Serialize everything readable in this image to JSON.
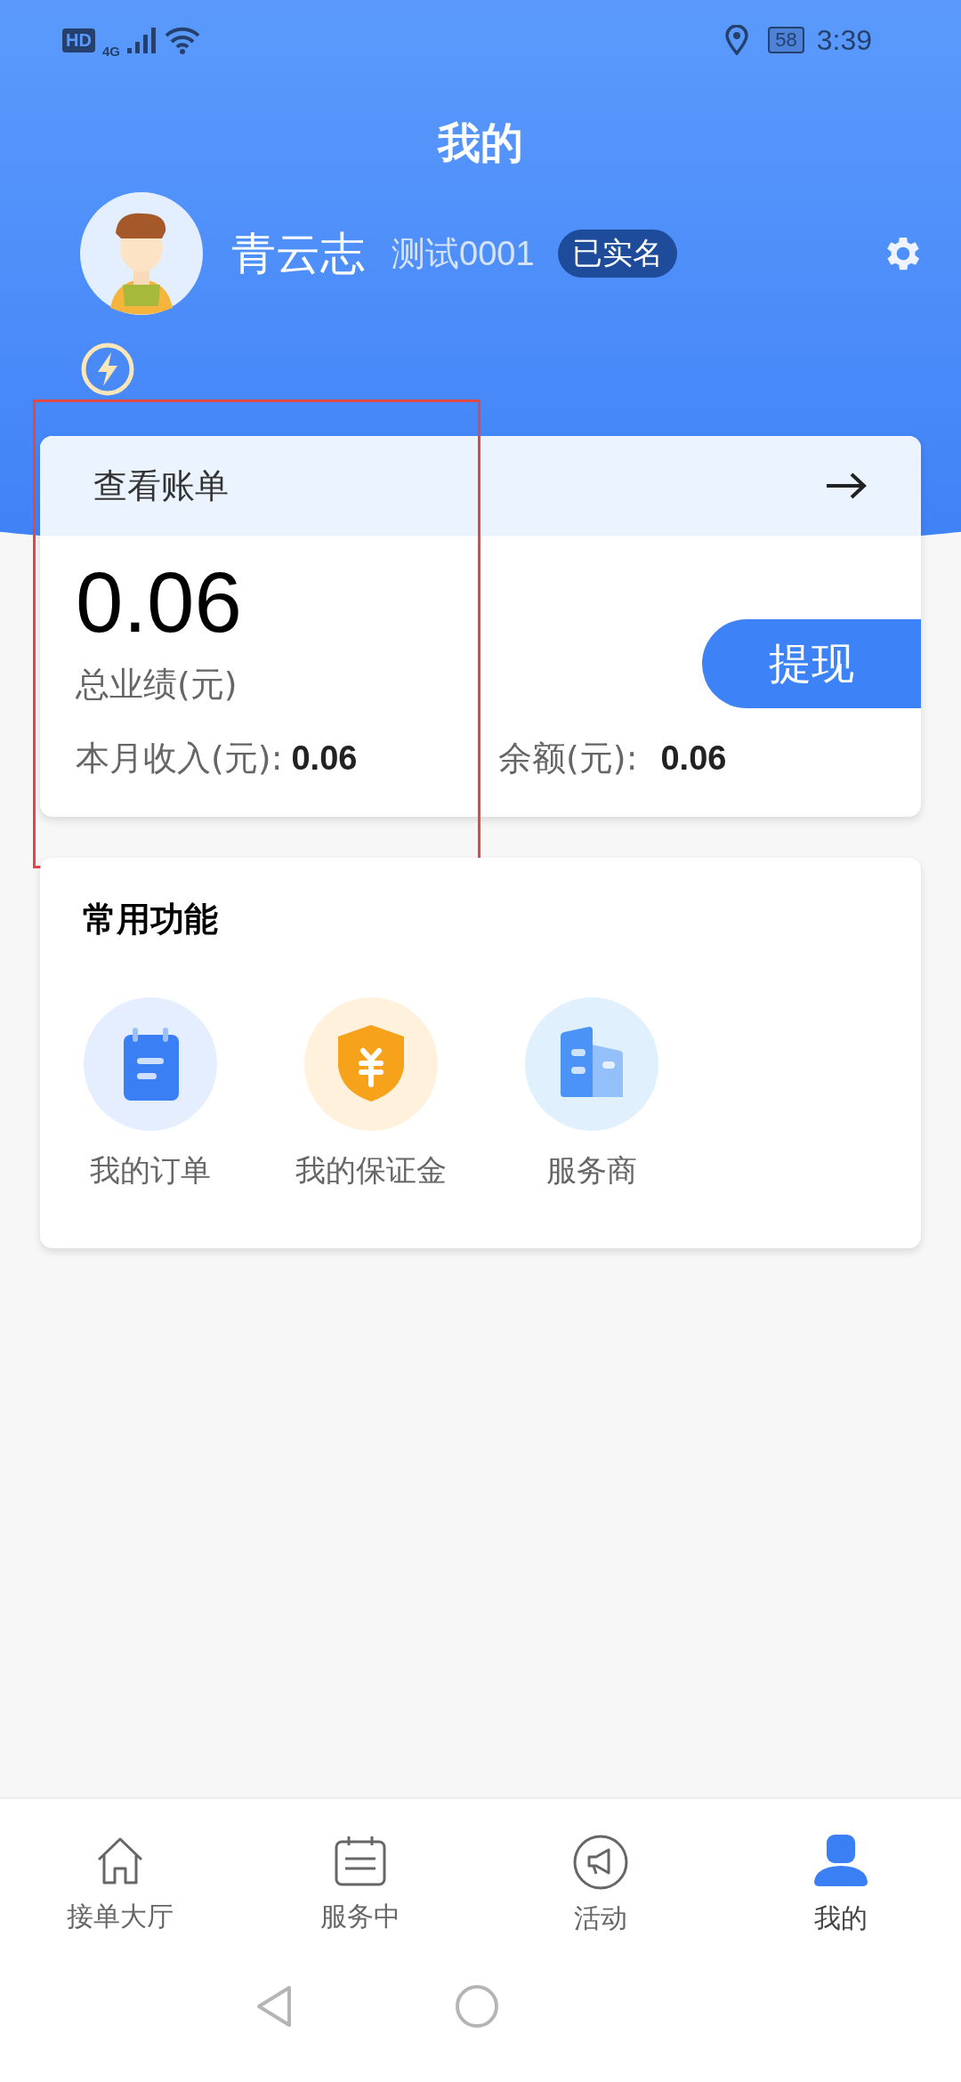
{
  "status_bar": {
    "hd": "HD",
    "network": "4G",
    "battery": "58",
    "time": "3:39"
  },
  "header": {
    "title": "我的"
  },
  "profile": {
    "name": "青云志",
    "account": "测试0001",
    "badge": "已实名"
  },
  "bill_card": {
    "link": "查看账单",
    "total": "0.06",
    "total_label": "总业绩(元)",
    "withdraw_button": "提现",
    "month_label": "本月收入(元):",
    "month_value": "0.06",
    "balance_label": "余额(元):",
    "balance_value": "0.06"
  },
  "functions": {
    "title": "常用功能",
    "items": [
      {
        "kind": "orders",
        "label": "我的订单"
      },
      {
        "kind": "deposit",
        "label": "我的保证金"
      },
      {
        "kind": "provider",
        "label": "服务商"
      }
    ]
  },
  "tabs": [
    {
      "kind": "home",
      "label": "接单大厅",
      "selected": false
    },
    {
      "kind": "calendar",
      "label": "服务中",
      "selected": false
    },
    {
      "kind": "megaphone",
      "label": "活动",
      "selected": false
    },
    {
      "kind": "person",
      "label": "我的",
      "selected": true
    }
  ]
}
